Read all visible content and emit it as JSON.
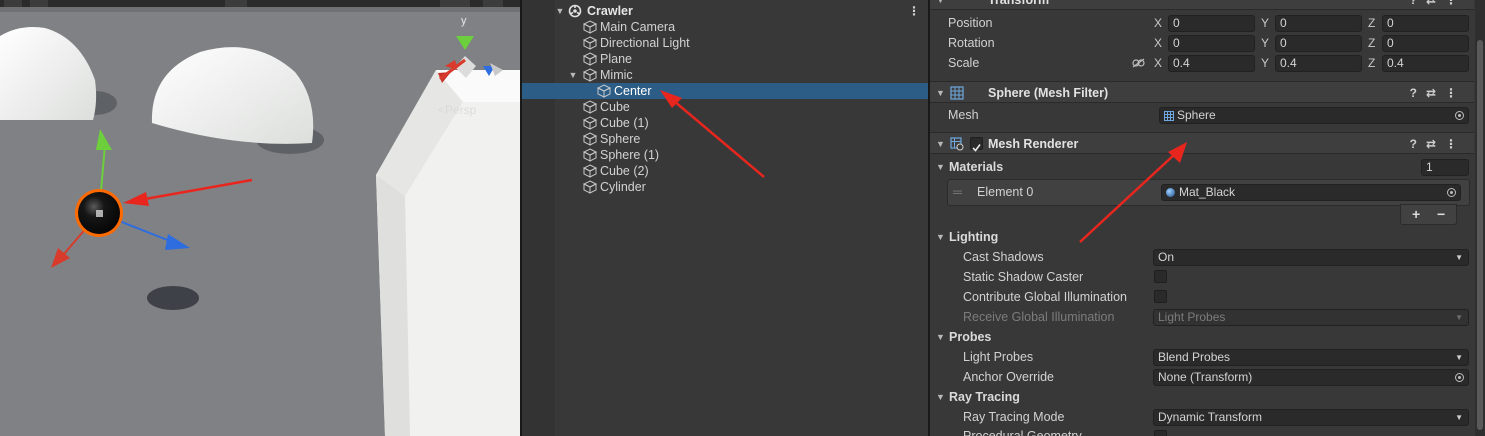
{
  "scene": {
    "persp_label": "<Persp",
    "gizmo_axis_label": "y"
  },
  "hierarchy": {
    "root_name": "Crawler",
    "items": [
      {
        "label": "Main Camera",
        "depth": 1,
        "selected": false,
        "has_children": false
      },
      {
        "label": "Directional Light",
        "depth": 1,
        "selected": false,
        "has_children": false
      },
      {
        "label": "Plane",
        "depth": 1,
        "selected": false,
        "has_children": false
      },
      {
        "label": "Mimic",
        "depth": 1,
        "selected": false,
        "has_children": true
      },
      {
        "label": "Center",
        "depth": 2,
        "selected": true,
        "has_children": false
      },
      {
        "label": "Cube",
        "depth": 1,
        "selected": false,
        "has_children": false
      },
      {
        "label": "Cube (1)",
        "depth": 1,
        "selected": false,
        "has_children": false
      },
      {
        "label": "Sphere",
        "depth": 1,
        "selected": false,
        "has_children": false
      },
      {
        "label": "Sphere (1)",
        "depth": 1,
        "selected": false,
        "has_children": false
      },
      {
        "label": "Cube (2)",
        "depth": 1,
        "selected": false,
        "has_children": false
      },
      {
        "label": "Cylinder",
        "depth": 1,
        "selected": false,
        "has_children": false
      }
    ]
  },
  "inspector": {
    "transform": {
      "title": "Transform",
      "position": {
        "label": "Position",
        "x": "0",
        "y": "0",
        "z": "0"
      },
      "rotation": {
        "label": "Rotation",
        "x": "0",
        "y": "0",
        "z": "0"
      },
      "scale": {
        "label": "Scale",
        "x": "0.4",
        "y": "0.4",
        "z": "0.4"
      }
    },
    "axes": {
      "x": "X",
      "y": "Y",
      "z": "Z"
    },
    "mesh_filter": {
      "title": "Sphere (Mesh Filter)",
      "mesh_label": "Mesh",
      "mesh_value": "Sphere"
    },
    "mesh_renderer": {
      "title": "Mesh Renderer",
      "enabled": true,
      "materials_label": "Materials",
      "materials_count": "1",
      "element_label": "Element 0",
      "element_value": "Mat_Black",
      "add_symbol": "+",
      "remove_symbol": "−",
      "lighting_label": "Lighting",
      "cast_shadows_label": "Cast Shadows",
      "cast_shadows_value": "On",
      "static_shadow_label": "Static Shadow Caster",
      "contribute_gi_label": "Contribute Global Illumination",
      "receive_gi_label": "Receive Global Illumination",
      "receive_gi_value": "Light Probes",
      "probes_label": "Probes",
      "light_probes_label": "Light Probes",
      "light_probes_value": "Blend Probes",
      "anchor_override_label": "Anchor Override",
      "anchor_override_value": "None (Transform)",
      "ray_tracing_label": "Ray Tracing",
      "ray_tracing_mode_label": "Ray Tracing Mode",
      "ray_tracing_mode_value": "Dynamic Transform",
      "procedural_geometry_label": "Procedural Geometry"
    }
  },
  "colors": {
    "selection": "#2c5d87",
    "annotation_arrow": "#e8261e",
    "x_axis": "#d83a2c",
    "y_axis": "#6ccf3b",
    "z_axis": "#2e6de0"
  }
}
